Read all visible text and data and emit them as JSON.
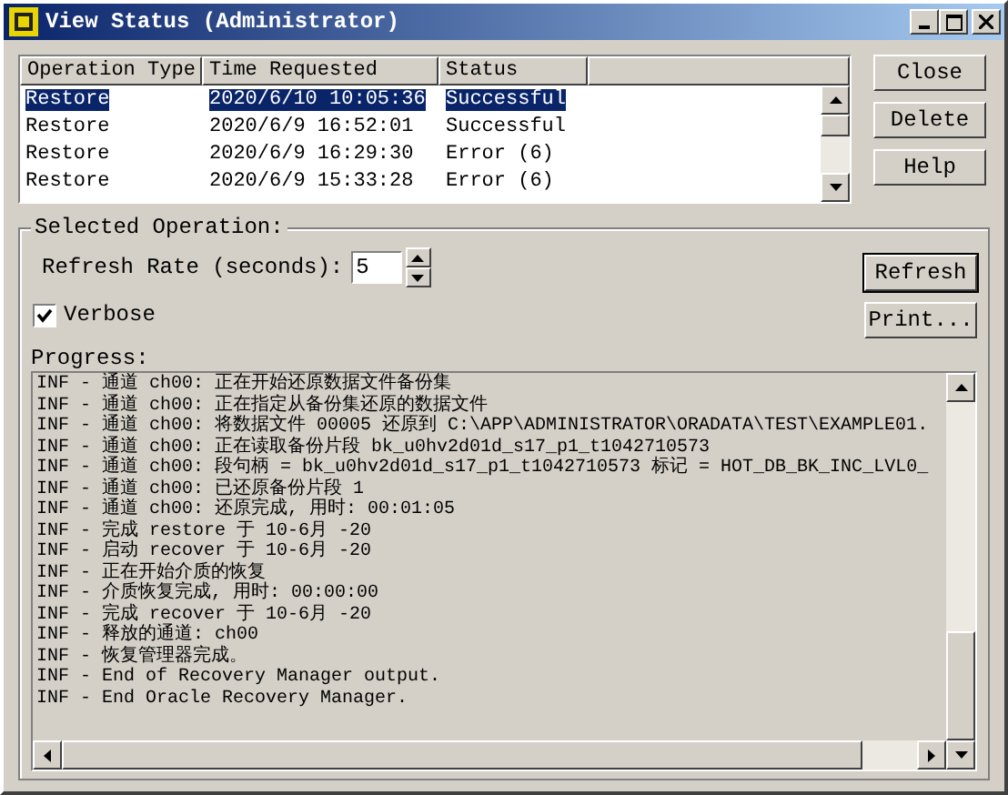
{
  "window": {
    "title": "View Status (Administrator)"
  },
  "operations": {
    "columns": [
      "Operation Type",
      "Time Requested",
      "Status"
    ],
    "rows": [
      {
        "type": "Restore",
        "time": "2020/6/10 10:05:36",
        "status": "Successful",
        "selected": true
      },
      {
        "type": "Restore",
        "time": "2020/6/9 16:52:01",
        "status": "Successful",
        "selected": false
      },
      {
        "type": "Restore",
        "time": "2020/6/9 16:29:30",
        "status": "Error (6)",
        "selected": false
      },
      {
        "type": "Restore",
        "time": "2020/6/9 15:33:28",
        "status": "Error (6)",
        "selected": false
      }
    ]
  },
  "side_buttons": [
    "Close",
    "Delete",
    "Help"
  ],
  "selected_operation": {
    "title": "Selected Operation:",
    "refresh_label": "Refresh Rate (seconds):",
    "refresh_value": "5",
    "verbose": {
      "label": "Verbose",
      "checked": true
    },
    "buttons": [
      "Refresh",
      "Print..."
    ],
    "progress_label": "Progress:",
    "progress_lines": [
      "INF - 通道 ch00: 正在开始还原数据文件备份集",
      "INF - 通道 ch00: 正在指定从备份集还原的数据文件",
      "INF - 通道 ch00: 将数据文件 00005 还原到 C:\\APP\\ADMINISTRATOR\\ORADATA\\TEST\\EXAMPLE01.",
      "INF - 通道 ch00: 正在读取备份片段 bk_u0hv2d01d_s17_p1_t1042710573",
      "INF - 通道 ch00: 段句柄 = bk_u0hv2d01d_s17_p1_t1042710573 标记 = HOT_DB_BK_INC_LVL0_",
      "INF - 通道 ch00: 已还原备份片段 1",
      "INF - 通道 ch00: 还原完成, 用时: 00:01:05",
      "INF - 完成 restore 于 10-6月 -20",
      "INF - 启动 recover 于 10-6月 -20",
      "INF - 正在开始介质的恢复",
      "INF - 介质恢复完成, 用时: 00:00:00",
      "INF - 完成 recover 于 10-6月 -20",
      "INF - 释放的通道: ch00",
      "INF - 恢复管理器完成。",
      "INF - End of Recovery Manager output.",
      "INF - End Oracle Recovery Manager."
    ]
  }
}
